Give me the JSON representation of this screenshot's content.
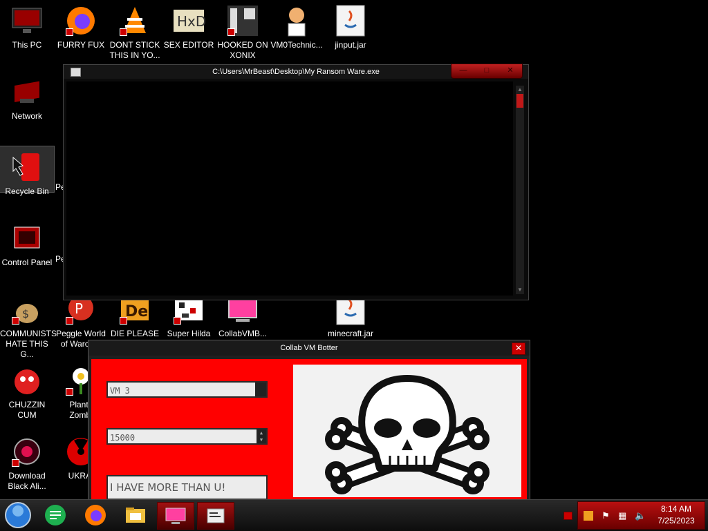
{
  "desktop": {
    "icons": [
      {
        "label": "This PC"
      },
      {
        "label": "FURRY FUX"
      },
      {
        "label": "DONT STICK\nTHIS IN YO..."
      },
      {
        "label": "SEX EDITOR"
      },
      {
        "label": "HOOKED ON\nXONIX"
      },
      {
        "label": "VM0Technic..."
      },
      {
        "label": "jinput.jar"
      },
      {
        "label": "Network"
      },
      {
        "label": "Recycle Bin"
      },
      {
        "label": "Control Panel"
      },
      {
        "label": "COMMUNISTS\nHATE THIS G..."
      },
      {
        "label": "Peggle World\nof Warcraft"
      },
      {
        "label": "DIE PLEASE"
      },
      {
        "label": "Super Hilda"
      },
      {
        "label": "CollabVMB..."
      },
      {
        "label": "minecraft.jar"
      },
      {
        "label": "CHUZZIN\nCUM"
      },
      {
        "label": "Plants\nZombi"
      },
      {
        "label": "Download\nBlack Ali..."
      },
      {
        "label": "UKRAI"
      }
    ],
    "partial_labels": [
      "Pe",
      "Pe",
      "Pe"
    ]
  },
  "console_window": {
    "title": "C:\\Users\\MrBeast\\Desktop\\My Ransom Ware.exe"
  },
  "botter_window": {
    "title": "Collab VM Botter",
    "vm_field": "VM 3",
    "count_field": "15000",
    "message_field": "I HAVE MORE THAN U!"
  },
  "taskbar": {
    "time": "8:14 AM",
    "date": "7/25/2023"
  },
  "colors": {
    "accent": "#ff0000",
    "dark_red": "#6a0000"
  }
}
